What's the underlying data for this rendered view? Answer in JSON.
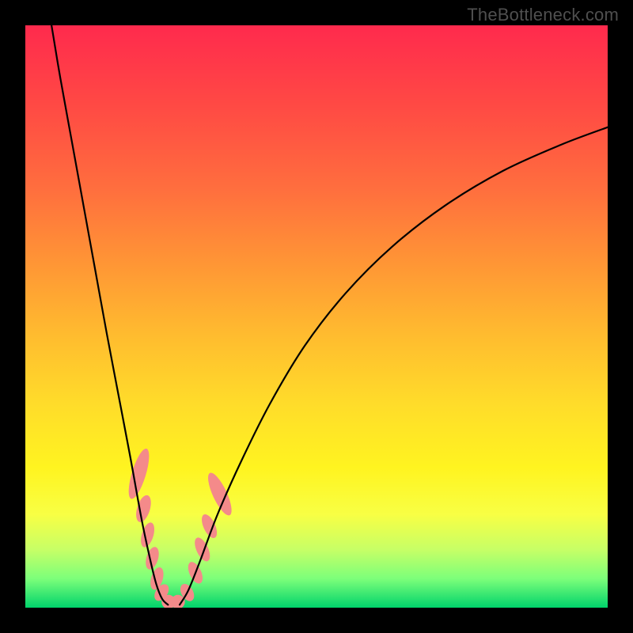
{
  "watermark": "TheBottleneck.com",
  "chart_data": {
    "type": "line",
    "title": "",
    "xlabel": "",
    "ylabel": "",
    "xlim": [
      0,
      100
    ],
    "ylim": [
      0,
      100
    ],
    "grid": false,
    "description": "V-shaped bottleneck curve (two branches) over a vertical rainbow gradient from red (top) to green (bottom), with pink marker pills near the valley.",
    "series": [
      {
        "name": "left-branch",
        "x": [
          4.5,
          6,
          8,
          10,
          12,
          14,
          16,
          18,
          20,
          21.5,
          22.5,
          23.5,
          24.5
        ],
        "values": [
          100,
          91,
          80,
          69,
          58,
          47,
          36.5,
          26,
          15,
          8,
          4,
          1.5,
          0.5
        ]
      },
      {
        "name": "right-branch",
        "x": [
          26.5,
          28,
          30,
          33,
          37,
          42,
          48,
          55,
          63,
          72,
          82,
          92,
          100
        ],
        "values": [
          0.5,
          3,
          8,
          16,
          25,
          35,
          45,
          54,
          62,
          69,
          75,
          79.5,
          82.5
        ]
      }
    ],
    "markers": {
      "name": "scatter-pills",
      "items": [
        {
          "cx": 19.5,
          "cy": 23,
          "rx": 1.2,
          "ry": 4.5,
          "rot": 17
        },
        {
          "cx": 20.3,
          "cy": 17,
          "rx": 1.1,
          "ry": 2.4,
          "rot": 17
        },
        {
          "cx": 21.0,
          "cy": 12.5,
          "rx": 1.0,
          "ry": 2.2,
          "rot": 17
        },
        {
          "cx": 21.8,
          "cy": 8.5,
          "rx": 1.0,
          "ry": 2.0,
          "rot": 17
        },
        {
          "cx": 22.6,
          "cy": 5.0,
          "rx": 1.0,
          "ry": 2.0,
          "rot": 17
        },
        {
          "cx": 23.4,
          "cy": 2.6,
          "rx": 1.0,
          "ry": 1.6,
          "rot": 35
        },
        {
          "cx": 24.6,
          "cy": 1.0,
          "rx": 1.2,
          "ry": 1.2,
          "rot": 0
        },
        {
          "cx": 26.2,
          "cy": 1.0,
          "rx": 1.2,
          "ry": 1.2,
          "rot": 0
        },
        {
          "cx": 27.8,
          "cy": 2.6,
          "rx": 1.0,
          "ry": 1.6,
          "rot": -30
        },
        {
          "cx": 29.2,
          "cy": 6.0,
          "rx": 1.0,
          "ry": 2.0,
          "rot": -25
        },
        {
          "cx": 30.4,
          "cy": 10.0,
          "rx": 1.0,
          "ry": 2.2,
          "rot": -25
        },
        {
          "cx": 31.6,
          "cy": 14.0,
          "rx": 1.0,
          "ry": 2.2,
          "rot": -25
        },
        {
          "cx": 33.4,
          "cy": 19.5,
          "rx": 1.2,
          "ry": 4.0,
          "rot": -25
        }
      ]
    },
    "colors": {
      "curve": "#000000",
      "marker_fill": "#f48a8a",
      "gradient_top": "#ff2a4d",
      "gradient_bottom": "#00d36b"
    }
  }
}
